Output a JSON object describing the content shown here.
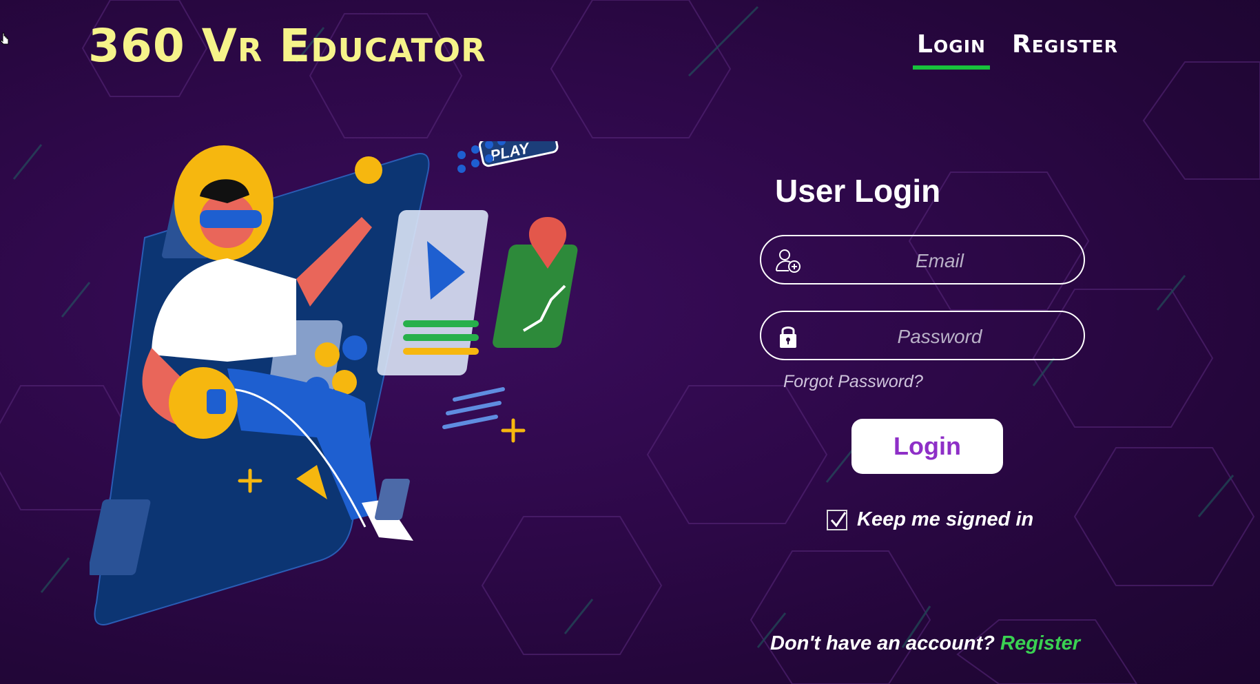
{
  "app": {
    "brand": "360 Vr Educator"
  },
  "nav": {
    "login": "Login",
    "register": "Register"
  },
  "form": {
    "title": "User Login",
    "email_placeholder": "Email",
    "password_placeholder": "Password",
    "forgot": "Forgot Password?",
    "submit": "Login",
    "keep_signed_in": "Keep me signed in",
    "keep_checked": true,
    "no_account": "Don't have an account?",
    "register_link": "Register"
  },
  "illustration": {
    "play_label": "PLAY"
  },
  "colors": {
    "brand": "#f6f38a",
    "accent_green": "#18c23c",
    "button_text": "#8e2fc7",
    "link": "#3ad152"
  },
  "icons": [
    "user-add-icon",
    "lock-icon",
    "checkmark-icon",
    "cursor-icon"
  ]
}
